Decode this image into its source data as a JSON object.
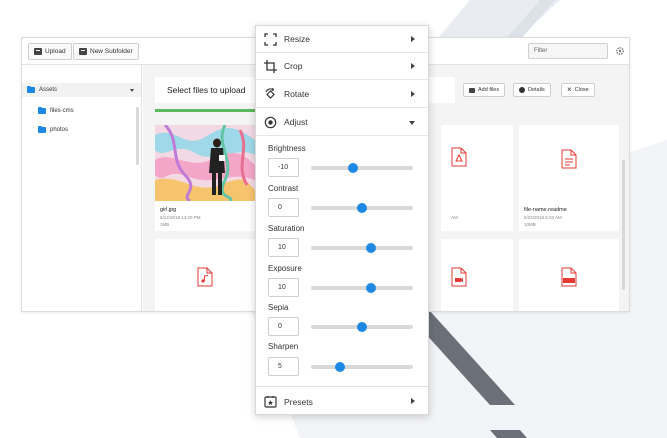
{
  "toolbar": {
    "upload_label": "Upload",
    "new_subfolder_label": "New Subfolder",
    "filter_placeholder": "Filter"
  },
  "sidebar": {
    "items": [
      {
        "label": "Assets",
        "expanded": true
      },
      {
        "label": "files-cms"
      },
      {
        "label": "photos"
      }
    ]
  },
  "main": {
    "upload_text": "Select files to upload",
    "add_files_label": "Add files",
    "details_label": "Details",
    "close_label": "Close",
    "cards": [
      {
        "name": "girl.jpg",
        "date": "6/12/2018 14:20 PM",
        "size": "1MB"
      },
      {
        "name": "file-name.readme",
        "date": "6/22/2018 6:32 AM",
        "size": "10MB"
      }
    ],
    "partial_meta": "AM"
  },
  "panel": {
    "menu": [
      {
        "label": "Resize",
        "icon": "resize-icon"
      },
      {
        "label": "Crop",
        "icon": "crop-icon"
      },
      {
        "label": "Rotate",
        "icon": "rotate-icon"
      },
      {
        "label": "Adjust",
        "icon": "adjust-icon",
        "expanded": true
      }
    ],
    "adjustments": [
      {
        "label": "Brightness",
        "value": "-10",
        "fraction": 0.41
      },
      {
        "label": "Contrast",
        "value": "0",
        "fraction": 0.5
      },
      {
        "label": "Saturation",
        "value": "10",
        "fraction": 0.59
      },
      {
        "label": "Exposure",
        "value": "10",
        "fraction": 0.59
      },
      {
        "label": "Sepia",
        "value": "0",
        "fraction": 0.5
      },
      {
        "label": "Sharpen",
        "value": "5",
        "fraction": 0.28
      }
    ],
    "presets_label": "Presets"
  },
  "colors": {
    "accent": "#1e88e5",
    "progress": "#5cb85c",
    "file_icon": "#e53935"
  }
}
